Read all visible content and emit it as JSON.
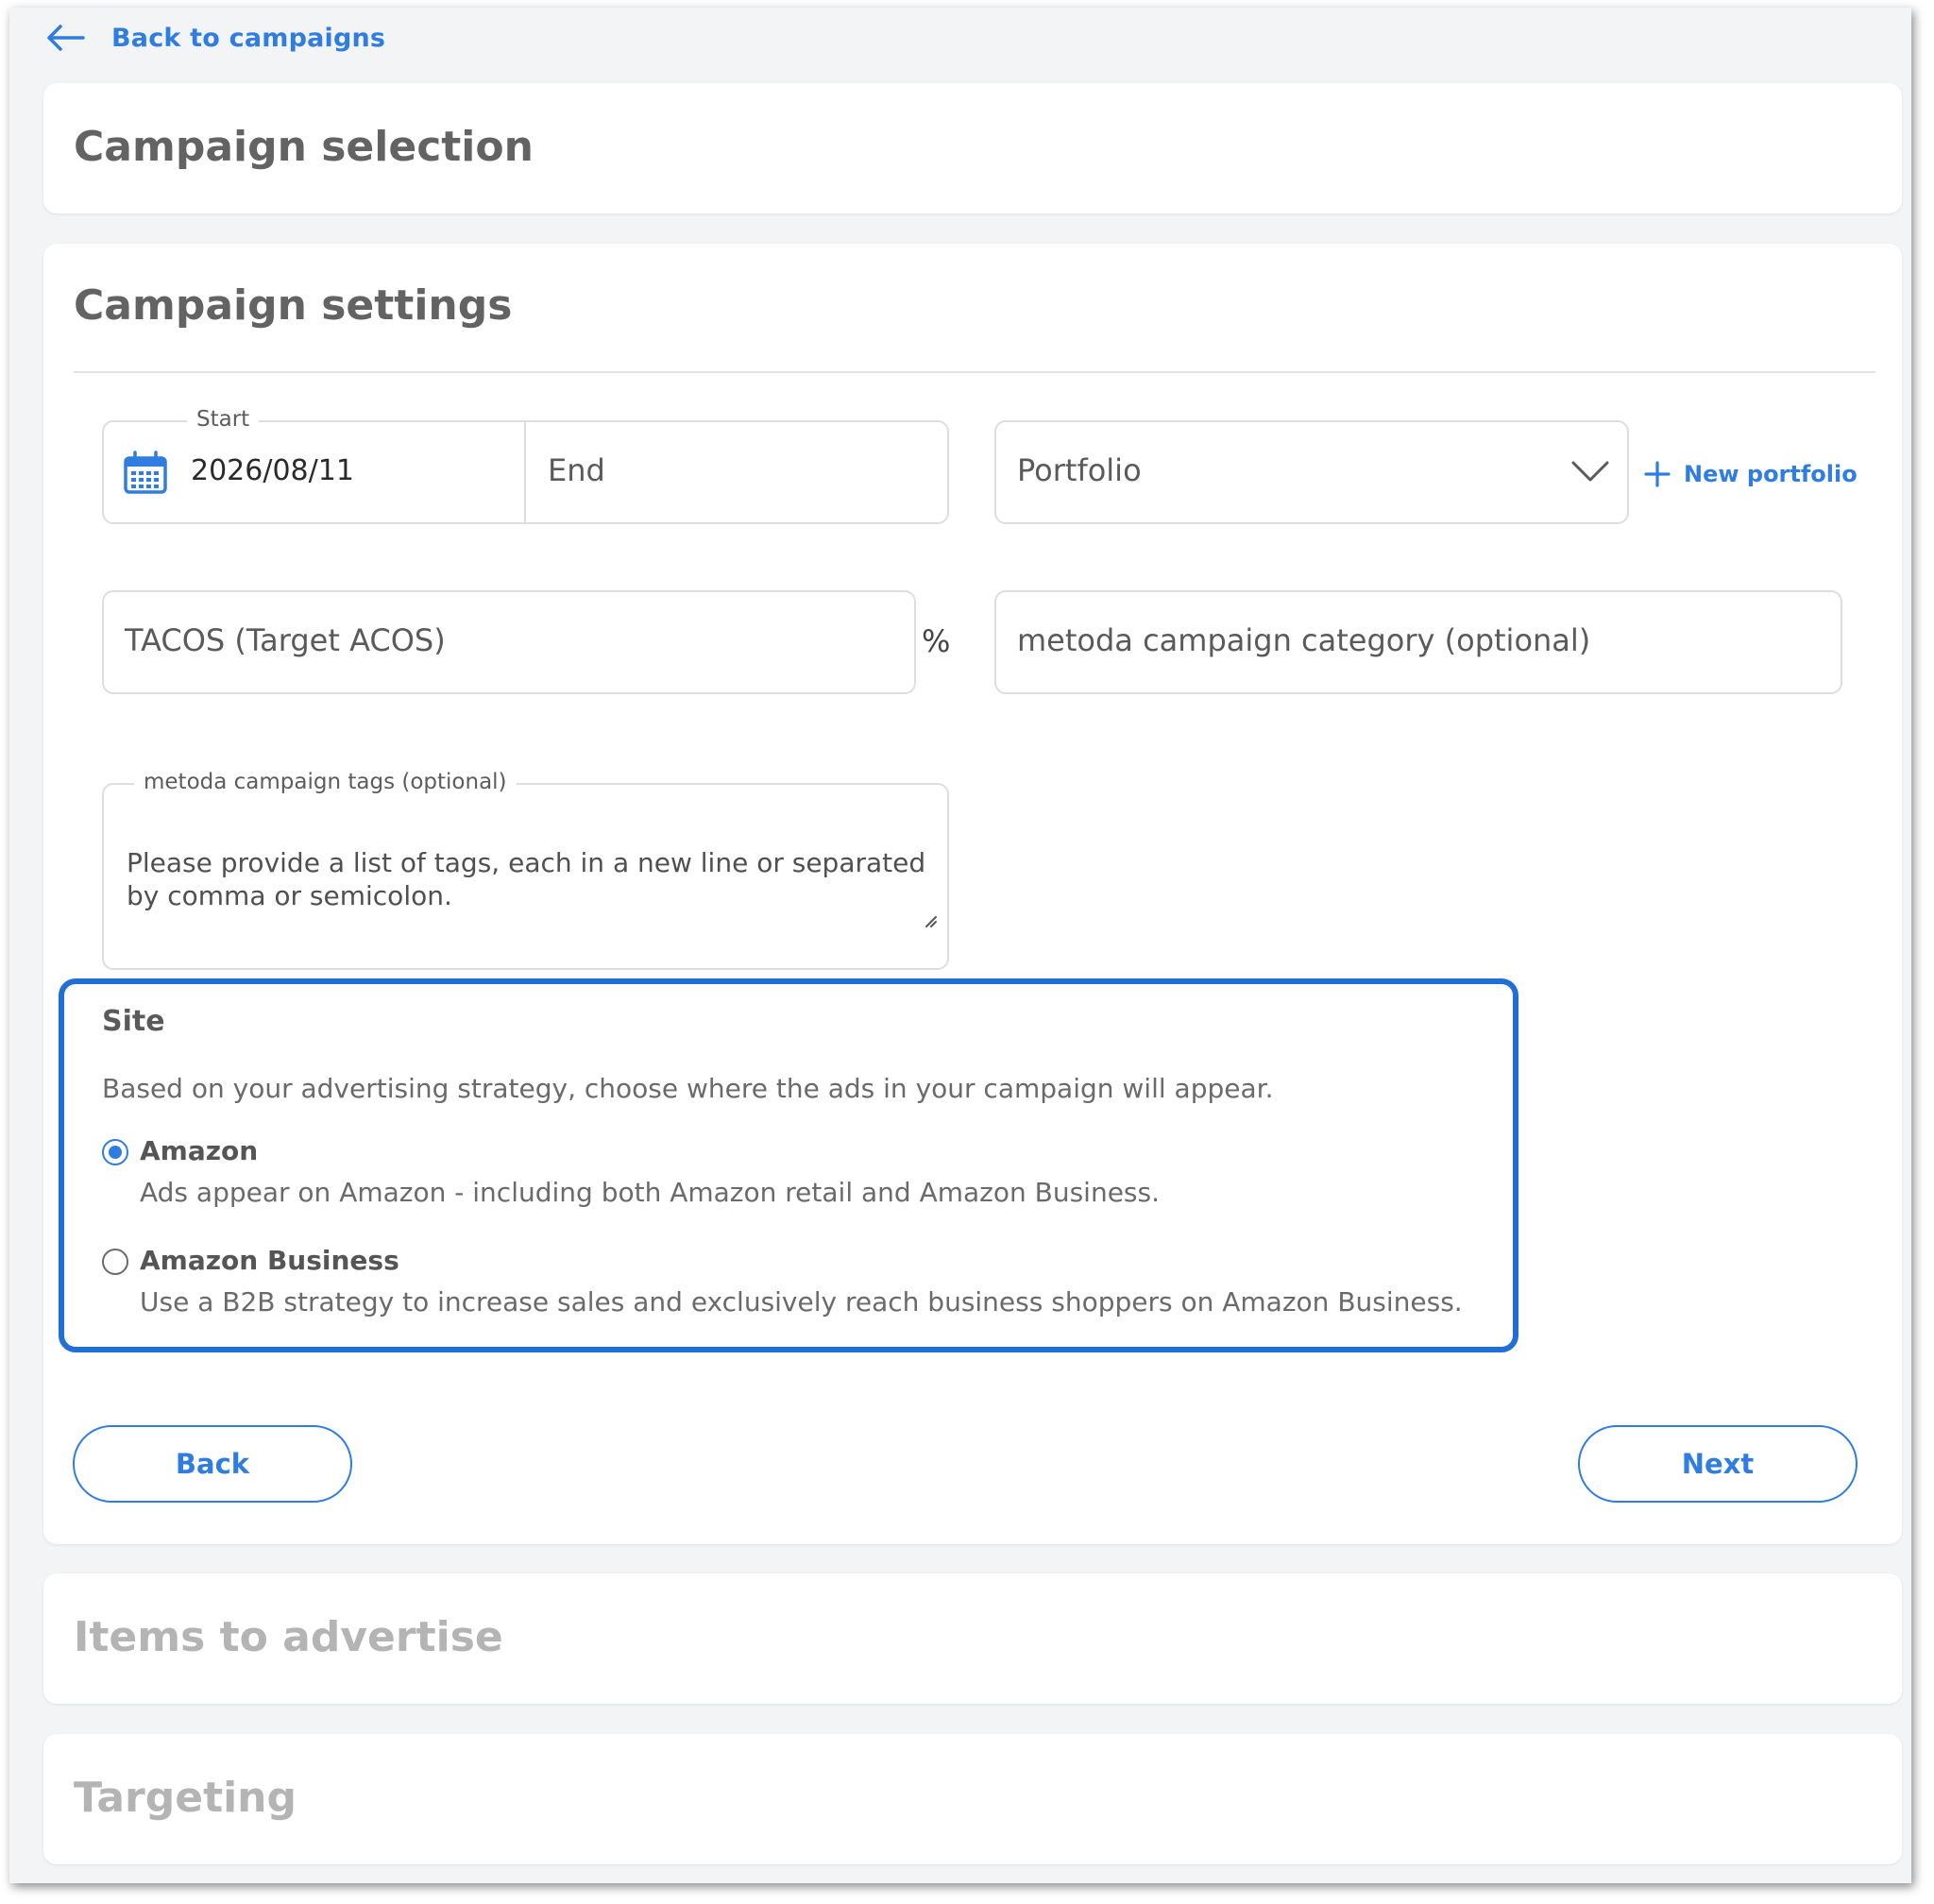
{
  "nav": {
    "back_label": "Back to campaigns"
  },
  "sections": {
    "campaign_selection": {
      "title": "Campaign selection"
    },
    "campaign_settings": {
      "title": "Campaign settings",
      "start": {
        "label": "Start",
        "value": "2026/08/11"
      },
      "end": {
        "placeholder": "End"
      },
      "portfolio": {
        "placeholder": "Portfolio",
        "new_label": "New portfolio"
      },
      "tacos": {
        "placeholder": "TACOS (Target ACOS)",
        "unit": "%"
      },
      "category": {
        "placeholder": "metoda campaign category (optional)"
      },
      "tags": {
        "label": "metoda campaign tags (optional)",
        "placeholder_line1": "Please provide a list of tags, each in a new line or separated",
        "placeholder_line2": "by comma or semicolon."
      },
      "site": {
        "title": "Site",
        "description": "Based on your advertising strategy, choose where the ads in your campaign will appear.",
        "selected": "Amazon",
        "options": [
          {
            "label": "Amazon",
            "description": "Ads appear on Amazon - including both Amazon retail and Amazon Business."
          },
          {
            "label": "Amazon Business",
            "description": "Use a B2B strategy to increase sales and exclusively reach business shoppers on Amazon Business."
          }
        ]
      },
      "buttons": {
        "back": "Back",
        "next": "Next"
      }
    },
    "items_to_advertise": {
      "title": "Items to advertise"
    },
    "targeting": {
      "title": "Targeting"
    }
  },
  "colors": {
    "accent": "#2f7de1",
    "highlight_border": "#1f6fd7",
    "muted_title": "#b4b4b4"
  }
}
